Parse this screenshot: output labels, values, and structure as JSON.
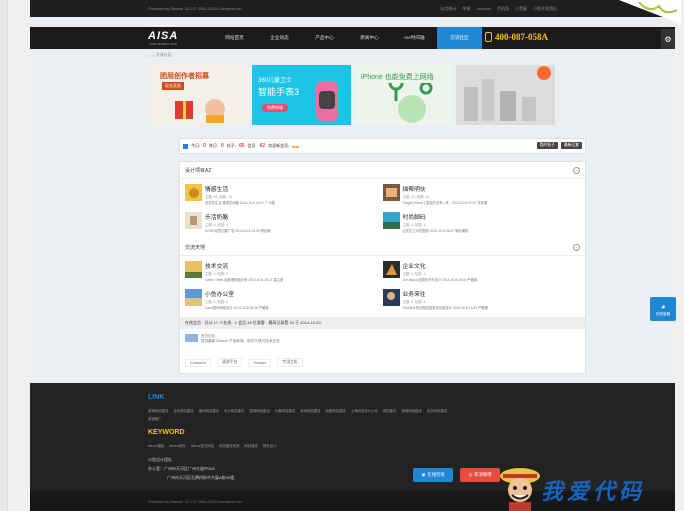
{
  "topstrip": {
    "copyright": "Powered by Discuz! X3.2 © 2001-2013 Comsenz Inc.",
    "links": [
      "站点统计",
      "举报",
      "Archiver",
      "手机版",
      "小黑屋",
      "小鱼开发团队"
    ]
  },
  "logo": {
    "main": "AISA",
    "sub": "FIRM INTERACTIVE"
  },
  "nav": {
    "items": [
      "网站首页",
      "企业动态",
      "产品中心",
      "新闻中心",
      "me时间轴",
      "交流社区"
    ],
    "active_index": 5,
    "phone": "400-087-058A"
  },
  "breadcrumb": [
    "⌂",
    "›",
    "交流社区"
  ],
  "banners": [
    {
      "title": "团屈创作者招募",
      "tag": "现金奖励"
    },
    {
      "title": "360儿童卫士",
      "title2": "智能手表3",
      "button": "免费申请"
    },
    {
      "title": "iPhone 也能免费上网络"
    },
    {
      "title": ""
    }
  ],
  "stats": {
    "today_label": "今日:",
    "today": "0",
    "yesterday_label": "昨日:",
    "yesterday": "0",
    "posts_label": "帖子:",
    "posts": "65",
    "members_label": "会员:",
    "members": "62",
    "newest_label": "欢迎新会员:",
    "newest": "test",
    "btn_my_posts": "我的帖子",
    "btn_latest": "最新回复"
  },
  "sections": [
    {
      "title": "设计项目AZ",
      "toggle": "−",
      "forums": [
        {
          "name": "情感生活",
          "meta": "主题: 16, 帖数: 16",
          "last": "鉴赏的生活 路用花间路 2014-10-8 13:07 广州箱"
        },
        {
          "name": "描帮明伙",
          "meta": "主题: 20, 帖数: 20",
          "last": "Fragile Future ( 鉴赏的未来 ) 来... 2014-10-8 07:57 伟伟喔"
        },
        {
          "name": "乐活奶酪",
          "meta": "主题: 4, 帖数: 4",
          "last": "SOHO创意加载广告 2014-10-8 14:30 博佳微"
        },
        {
          "name": "时尚脚码",
          "meta": "主题: 4, 帖数: 4",
          "last": "应发生之中的图形 2014-10-8 06:37 落彩潮鞋"
        }
      ]
    },
    {
      "title": "交流天地",
      "toggle": "−",
      "forums": [
        {
          "name": "技术交流",
          "meta": "主题: 4, 帖数: 4",
          "last": "Green Trees 绘着墙情图示例 2014-10-8 16:21 建主被"
        },
        {
          "name": "企业文化",
          "meta": "主题: 4, 帖数: 4",
          "last": "Joe discuz加强的汽车设计 2014-10-8 16:04 严傲微"
        },
        {
          "name": "小鱼办公室",
          "meta": "主题: 4, 帖数: 4",
          "last": "Lanvi制作网络设计 2014-10-8 06:16 严傲微"
        },
        {
          "name": "业务来往",
          "meta": "主题: 4, 帖数: 4",
          "last": "SKA设计的近期交易室多功能设计 2014-10-8 13:29 严傲微"
        }
      ]
    }
  ],
  "online": {
    "text": "在线会员 - 总计 17 人在线 - 1 会员,16 位游客 - 最高记录是 34 于 2014-10-23."
  },
  "official": {
    "title": "官方论坛",
    "desc": "提供最新 Discuz! 产品新闻、软件下载与技术交流"
  },
  "friend_links": [
    "Comsenz",
    "漫游平台",
    "Yeswan",
    "专用主机"
  ],
  "footer": {
    "link_title": "LINK",
    "links_row1": [
      "营销网站建设",
      "台北网站建设",
      "福州网站建设",
      "长沙网站建设",
      "昆明网站建设",
      "长春网站建设",
      "深圳网站建设",
      "成都网站建设",
      "上海网站设计公司",
      "网站建设",
      "深圳网站建设",
      "北京网站建设"
    ],
    "links_row2": [
      "营销推广"
    ],
    "keyword_title": "KEYWORD",
    "keywords": [
      "discuz模板",
      "discuz插件",
      "discuz官方网站",
      "网站建设系统",
      "网站建设",
      "网页设计"
    ],
    "team": "小鱼设计团队",
    "addr1": "办公室：广州市天河区广州大道中356",
    "addr2": "广州市天河区石牌桥街中大厦A栋30楼",
    "btn_qq": "在线咨询",
    "btn_weibo": "新浪微博",
    "copyright": "Powered by Discuz! X3.2 © 2001-2013 Comsenz Inc."
  },
  "side_qq": {
    "label": "在线客服"
  },
  "watermark": "我爱代码",
  "colors": {
    "accent": "#1e88d5",
    "phone": "#f5c400",
    "highlight": "#e44"
  }
}
